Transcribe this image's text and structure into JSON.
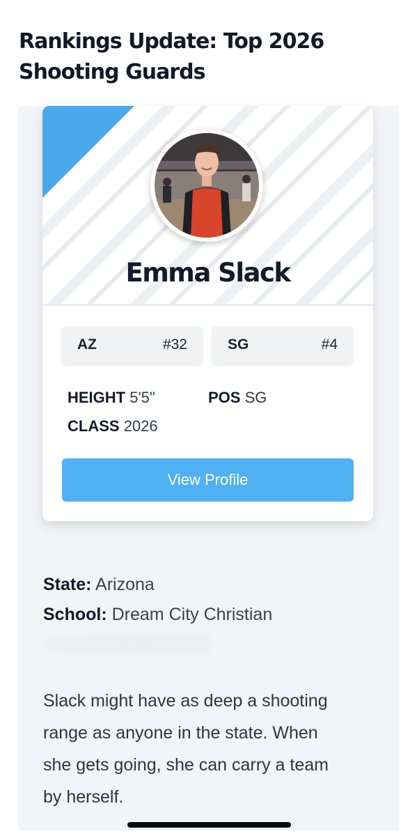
{
  "article": {
    "title": "Rankings Update: Top 2026 Shooting Guards"
  },
  "player_card": {
    "name": "Emma Slack",
    "avatar_alt": "player-photo",
    "state_rank": {
      "label": "AZ",
      "value": "#32"
    },
    "position_rank": {
      "label": "SG",
      "value": "#4"
    },
    "stats": {
      "height_label": "HEIGHT",
      "height_value": "5'5\"",
      "pos_label": "POS",
      "pos_value": "SG",
      "class_label": "CLASS",
      "class_value": "2026"
    },
    "button_label": "View Profile"
  },
  "details": {
    "state_label": "State:",
    "state_value": "Arizona",
    "school_label": "School:",
    "school_value": "Dream City Christian"
  },
  "description": "Slack might have as deep a shooting range as anyone in the state. When she gets going, she can carry a team by herself.",
  "colors": {
    "accent": "#4ba8ea",
    "button": "#4fb0f2",
    "panel_bg": "#f3f4f7"
  }
}
